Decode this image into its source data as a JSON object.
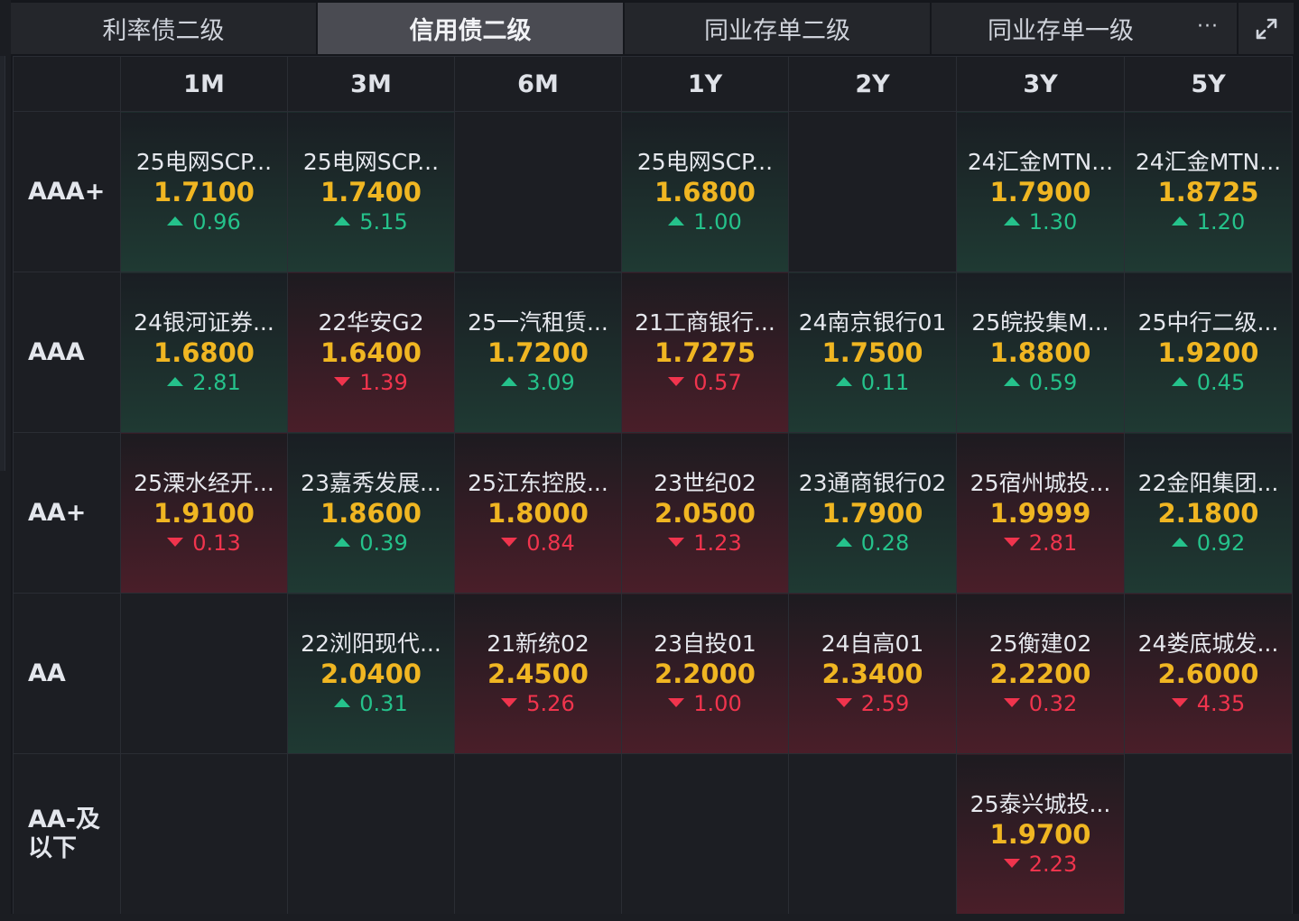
{
  "tabs": [
    {
      "label": "利率债二级",
      "active": false
    },
    {
      "label": "信用债二级",
      "active": true
    },
    {
      "label": "同业存单二级",
      "active": false
    },
    {
      "label": "同业存单一级",
      "active": false
    }
  ],
  "more_label": "···",
  "columns": [
    "1M",
    "3M",
    "6M",
    "1Y",
    "2Y",
    "3Y",
    "5Y"
  ],
  "rows": [
    {
      "rating": "AAA+",
      "cells": [
        {
          "name": "25电网SCP...",
          "rate": "1.7100",
          "change": "0.96",
          "dir": "up"
        },
        {
          "name": "25电网SCP...",
          "rate": "1.7400",
          "change": "5.15",
          "dir": "up"
        },
        null,
        {
          "name": "25电网SCP...",
          "rate": "1.6800",
          "change": "1.00",
          "dir": "up"
        },
        null,
        {
          "name": "24汇金MTN...",
          "rate": "1.7900",
          "change": "1.30",
          "dir": "up"
        },
        {
          "name": "24汇金MTN...",
          "rate": "1.8725",
          "change": "1.20",
          "dir": "up"
        }
      ]
    },
    {
      "rating": "AAA",
      "cells": [
        {
          "name": "24银河证券...",
          "rate": "1.6800",
          "change": "2.81",
          "dir": "up"
        },
        {
          "name": "22华安G2",
          "rate": "1.6400",
          "change": "1.39",
          "dir": "down"
        },
        {
          "name": "25一汽租赁...",
          "rate": "1.7200",
          "change": "3.09",
          "dir": "up"
        },
        {
          "name": "21工商银行...",
          "rate": "1.7275",
          "change": "0.57",
          "dir": "down"
        },
        {
          "name": "24南京银行01",
          "rate": "1.7500",
          "change": "0.11",
          "dir": "up"
        },
        {
          "name": "25皖投集M...",
          "rate": "1.8800",
          "change": "0.59",
          "dir": "up"
        },
        {
          "name": "25中行二级...",
          "rate": "1.9200",
          "change": "0.45",
          "dir": "up"
        }
      ]
    },
    {
      "rating": "AA+",
      "cells": [
        {
          "name": "25溧水经开...",
          "rate": "1.9100",
          "change": "0.13",
          "dir": "down"
        },
        {
          "name": "23嘉秀发展...",
          "rate": "1.8600",
          "change": "0.39",
          "dir": "up"
        },
        {
          "name": "25江东控股...",
          "rate": "1.8000",
          "change": "0.84",
          "dir": "down"
        },
        {
          "name": "23世纪02",
          "rate": "2.0500",
          "change": "1.23",
          "dir": "down"
        },
        {
          "name": "23通商银行02",
          "rate": "1.7900",
          "change": "0.28",
          "dir": "up"
        },
        {
          "name": "25宿州城投...",
          "rate": "1.9999",
          "change": "2.81",
          "dir": "down"
        },
        {
          "name": "22金阳集团...",
          "rate": "2.1800",
          "change": "0.92",
          "dir": "up"
        }
      ]
    },
    {
      "rating": "AA",
      "cells": [
        null,
        {
          "name": "22浏阳现代...",
          "rate": "2.0400",
          "change": "0.31",
          "dir": "up"
        },
        {
          "name": "21新统02",
          "rate": "2.4500",
          "change": "5.26",
          "dir": "down"
        },
        {
          "name": "23自投01",
          "rate": "2.2000",
          "change": "1.00",
          "dir": "down"
        },
        {
          "name": "24自高01",
          "rate": "2.3400",
          "change": "2.59",
          "dir": "down"
        },
        {
          "name": "25衡建02",
          "rate": "2.2200",
          "change": "0.32",
          "dir": "down"
        },
        {
          "name": "24娄底城发...",
          "rate": "2.6000",
          "change": "4.35",
          "dir": "down"
        }
      ]
    },
    {
      "rating": "AA-及以下",
      "cells": [
        null,
        null,
        null,
        null,
        null,
        {
          "name": "25泰兴城投...",
          "rate": "1.9700",
          "change": "2.23",
          "dir": "down"
        },
        null
      ]
    }
  ],
  "colors": {
    "up": "#25c28b",
    "down": "#f0344d",
    "rate": "#f0b622",
    "active_tab": "#4a4b52"
  }
}
